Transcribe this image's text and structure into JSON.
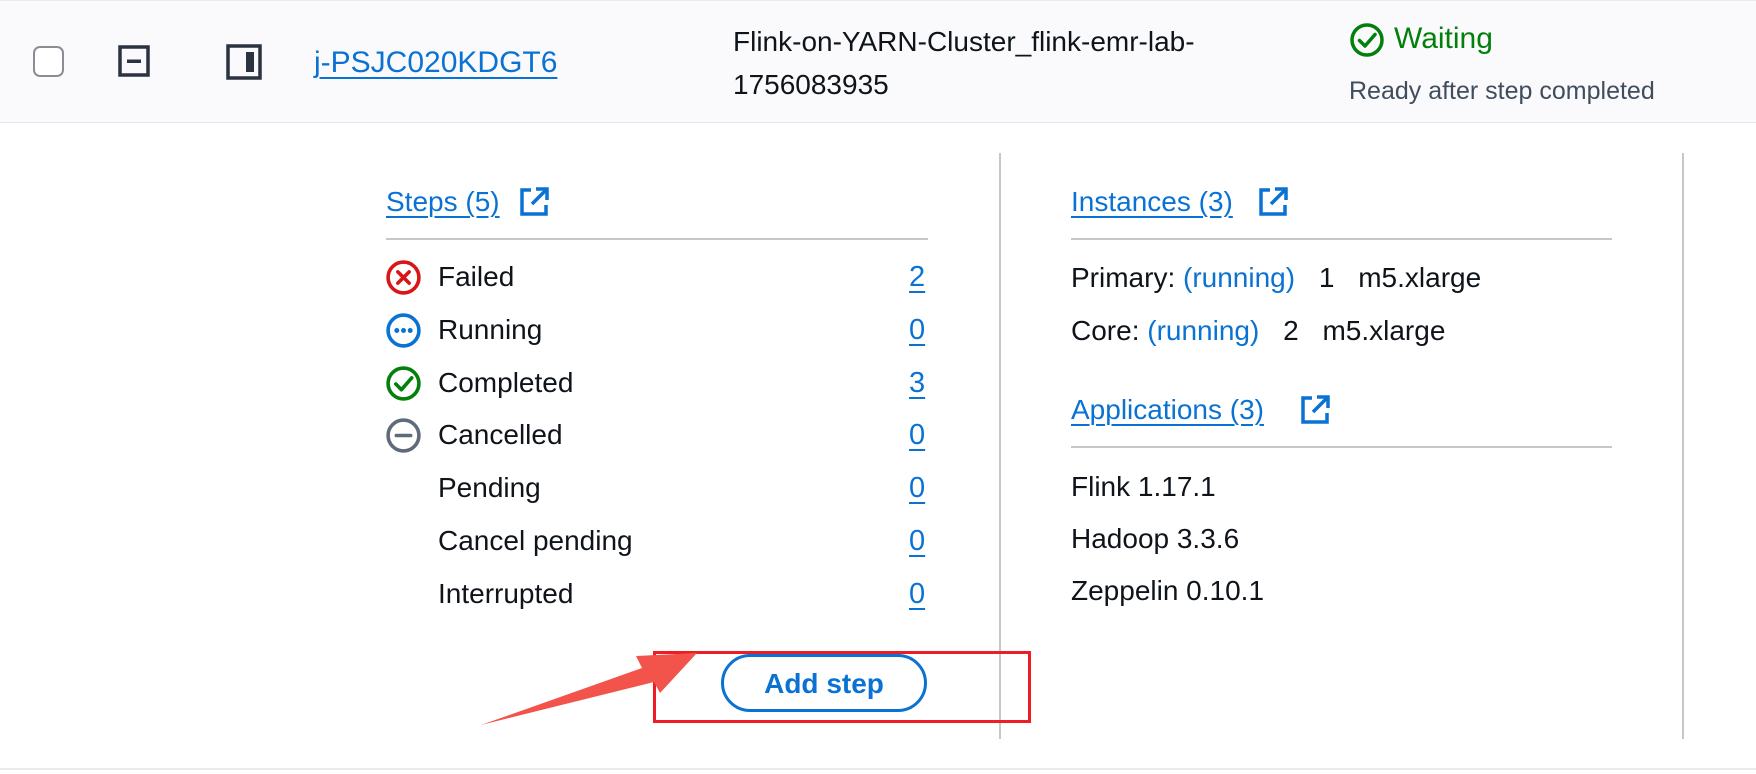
{
  "cluster": {
    "id": "j-PSJC020KDGT6",
    "name_line1": "Flink-on-YARN-Cluster_flink-emr-lab-",
    "name_line2": "1756083935",
    "status": "Waiting",
    "status_detail": "Ready after step completed"
  },
  "steps": {
    "title": "Steps (5)",
    "items": [
      {
        "label": "Failed",
        "count": "2",
        "icon": "x-circle-icon",
        "color": "#d91515"
      },
      {
        "label": "Running",
        "count": "0",
        "icon": "ellipsis-circle-icon",
        "color": "#0972d3"
      },
      {
        "label": "Completed",
        "count": "3",
        "icon": "check-circle-icon",
        "color": "#037f0c"
      },
      {
        "label": "Cancelled",
        "count": "0",
        "icon": "minus-circle-icon",
        "color": "#5f6b7a"
      },
      {
        "label": "Pending",
        "count": "0",
        "icon": "",
        "color": ""
      },
      {
        "label": "Cancel pending",
        "count": "0",
        "icon": "",
        "color": ""
      },
      {
        "label": "Interrupted",
        "count": "0",
        "icon": "",
        "color": ""
      }
    ],
    "add_button": "Add step"
  },
  "instances": {
    "title": "Instances (3)",
    "primary": {
      "label": "Primary:",
      "state": "(running)",
      "count": "1",
      "type": "m5.xlarge"
    },
    "core": {
      "label": "Core:",
      "state": "(running)",
      "count": "2",
      "type": "m5.xlarge"
    }
  },
  "applications": {
    "title": "Applications (3)",
    "items": [
      "Flink 1.17.1",
      "Hadoop 3.3.6",
      "Zeppelin 0.10.1"
    ]
  },
  "colors": {
    "link": "#0972d3",
    "success": "#037f0c",
    "error": "#d91515",
    "highlight": "#ee1c25",
    "arrow": "#f2544b"
  }
}
